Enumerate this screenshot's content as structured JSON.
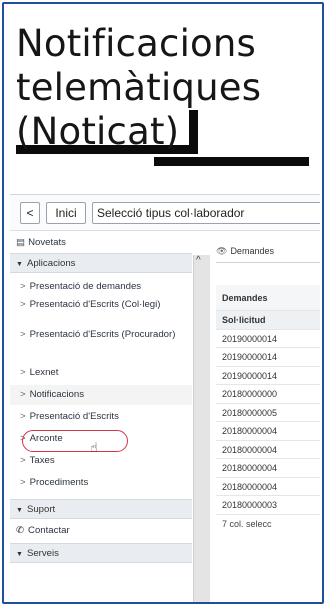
{
  "title": {
    "line1": "Notificacions",
    "line2": "telemàtiques",
    "line3": "(Noticat)"
  },
  "toolbar": {
    "back": "<",
    "home": "Inici",
    "selector": "Selecció tipus col·laborador"
  },
  "sidebar": {
    "novetats": "Novetats",
    "aplicacions": "Aplicacions",
    "items": [
      "Presentació de demandes",
      "Presentació d'Escrits (Col·legi)",
      "Presentació d'Escrits (Procurador)",
      "Lexnet",
      "Notificacions",
      "Presentació d'Escrits",
      "Arconte",
      "Taxes",
      "Procediments"
    ],
    "suport": "Suport",
    "contactar": "Contactar",
    "serveis": "Serveis"
  },
  "main": {
    "tab": "Demandes",
    "table": {
      "header1": "Demandes",
      "header2": "Sol·licitud",
      "rows": [
        "20190000014",
        "20190000014",
        "20190000014",
        "20180000000",
        "20180000005",
        "20180000004",
        "20180000004",
        "20180000004",
        "20180000004",
        "20180000003"
      ],
      "footer": "7 col. selecc"
    }
  }
}
